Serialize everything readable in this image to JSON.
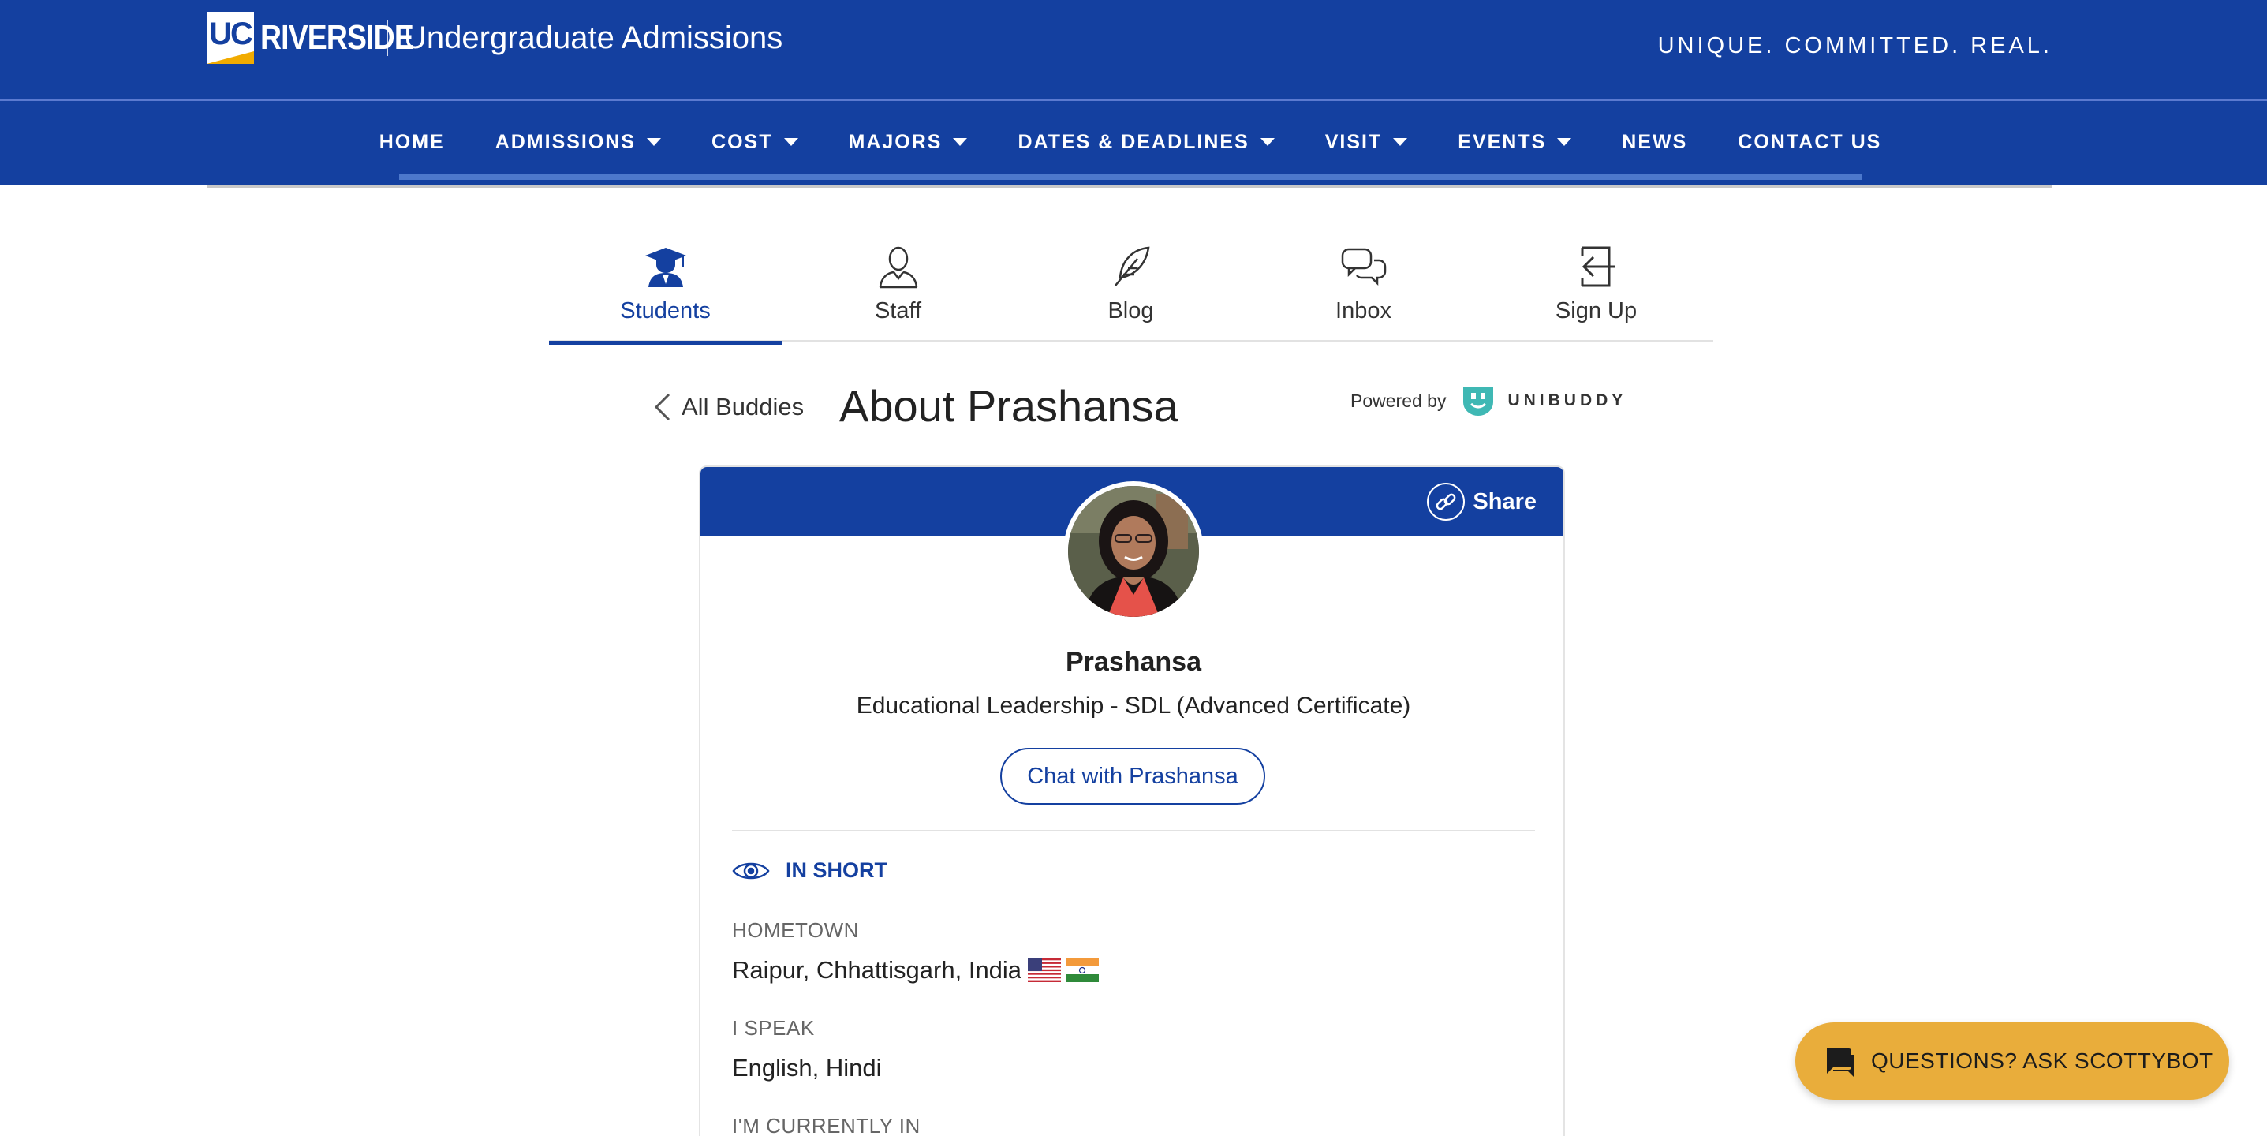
{
  "header": {
    "logo_badge": "UC",
    "logo_word": "RIVERSIDE",
    "site_title": "Undergraduate Admissions",
    "tagline": "UNIQUE. COMMITTED. REAL."
  },
  "nav": {
    "items": [
      {
        "label": "HOME",
        "dropdown": false
      },
      {
        "label": "ADMISSIONS",
        "dropdown": true
      },
      {
        "label": "COST",
        "dropdown": true
      },
      {
        "label": "MAJORS",
        "dropdown": true
      },
      {
        "label": "DATES & DEADLINES",
        "dropdown": true
      },
      {
        "label": "VISIT",
        "dropdown": true
      },
      {
        "label": "EVENTS",
        "dropdown": true
      },
      {
        "label": "NEWS",
        "dropdown": false
      },
      {
        "label": "CONTACT US",
        "dropdown": false
      }
    ]
  },
  "tabs": [
    {
      "label": "Students",
      "icon": "graduate-icon",
      "active": true
    },
    {
      "label": "Staff",
      "icon": "person-icon",
      "active": false
    },
    {
      "label": "Blog",
      "icon": "quill-icon",
      "active": false
    },
    {
      "label": "Inbox",
      "icon": "chat-bubbles-icon",
      "active": false
    },
    {
      "label": "Sign Up",
      "icon": "sign-in-icon",
      "active": false
    }
  ],
  "page": {
    "back_label": "All Buddies",
    "title": "About Prashansa",
    "powered_by": "Powered by",
    "brand": "UNIBUDDY"
  },
  "profile": {
    "share_label": "Share",
    "name": "Prashansa",
    "program": "Educational Leadership - SDL (Advanced Certificate)",
    "chat_label": "Chat with Prashansa",
    "section_title": "IN SHORT",
    "fields": [
      {
        "label": "HOMETOWN",
        "value": "Raipur, Chhattisgarh, India"
      },
      {
        "label": "I SPEAK",
        "value": "English, Hindi"
      },
      {
        "label": "I'M CURRENTLY IN",
        "value": ""
      }
    ]
  },
  "chatbot": {
    "label": "QUESTIONS? ASK SCOTTYBOT"
  },
  "colors": {
    "brand_blue": "#1440a0",
    "gold": "#e9ad3b"
  }
}
